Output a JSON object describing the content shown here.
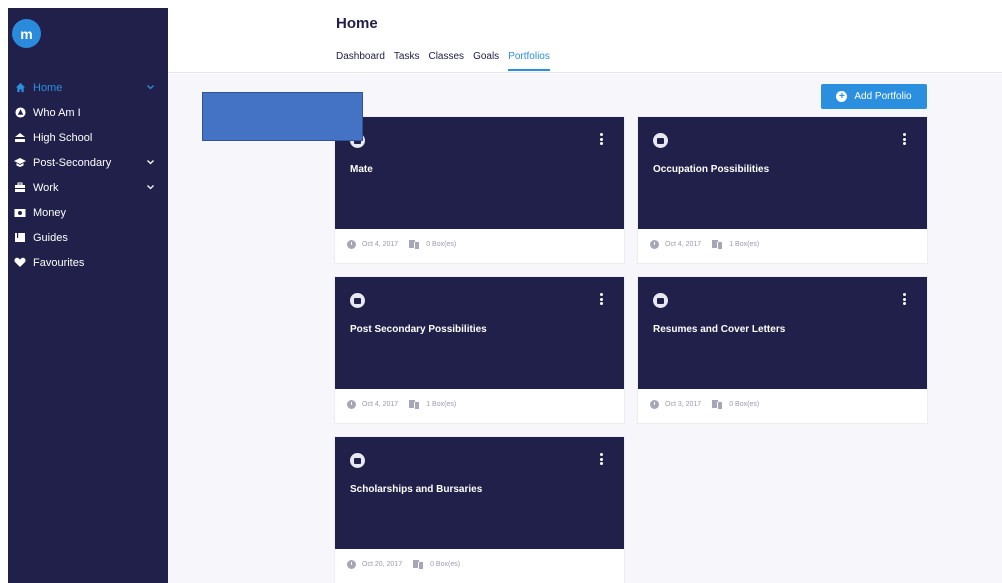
{
  "app": {
    "logo_text": "m",
    "accent_color": "#2b8fe0",
    "sidebar_color": "#20204a"
  },
  "sidebar": {
    "items": [
      {
        "label": "Home",
        "icon": "home-icon",
        "active": true,
        "expandable": true
      },
      {
        "label": "Who Am I",
        "icon": "user-circle-icon",
        "active": false,
        "expandable": false
      },
      {
        "label": "High School",
        "icon": "school-icon",
        "active": false,
        "expandable": false
      },
      {
        "label": "Post-Secondary",
        "icon": "graduation-cap-icon",
        "active": false,
        "expandable": true
      },
      {
        "label": "Work",
        "icon": "briefcase-icon",
        "active": false,
        "expandable": true
      },
      {
        "label": "Money",
        "icon": "money-icon",
        "active": false,
        "expandable": false
      },
      {
        "label": "Guides",
        "icon": "book-icon",
        "active": false,
        "expandable": false
      },
      {
        "label": "Favourites",
        "icon": "heart-icon",
        "active": false,
        "expandable": false
      }
    ]
  },
  "header": {
    "title": "Home",
    "tabs": [
      {
        "label": "Dashboard",
        "active": false
      },
      {
        "label": "Tasks",
        "active": false
      },
      {
        "label": "Classes",
        "active": false
      },
      {
        "label": "Goals",
        "active": false
      },
      {
        "label": "Portfolios",
        "active": true
      }
    ]
  },
  "main": {
    "add_button_label": "Add Portfolio",
    "cards": [
      {
        "title": "Mate",
        "date": "Oct 4, 2017",
        "boxes": "0 Box(es)"
      },
      {
        "title": "Occupation Possibilities",
        "date": "Oct 4, 2017",
        "boxes": "1 Box(es)"
      },
      {
        "title": "Post Secondary Possibilities",
        "date": "Oct 4, 2017",
        "boxes": "1 Box(es)"
      },
      {
        "title": "Resumes and Cover Letters",
        "date": "Oct 3, 2017",
        "boxes": "0 Box(es)"
      },
      {
        "title": "Scholarships and Bursaries",
        "date": "Oct 20, 2017",
        "boxes": "0 Box(es)"
      }
    ]
  }
}
